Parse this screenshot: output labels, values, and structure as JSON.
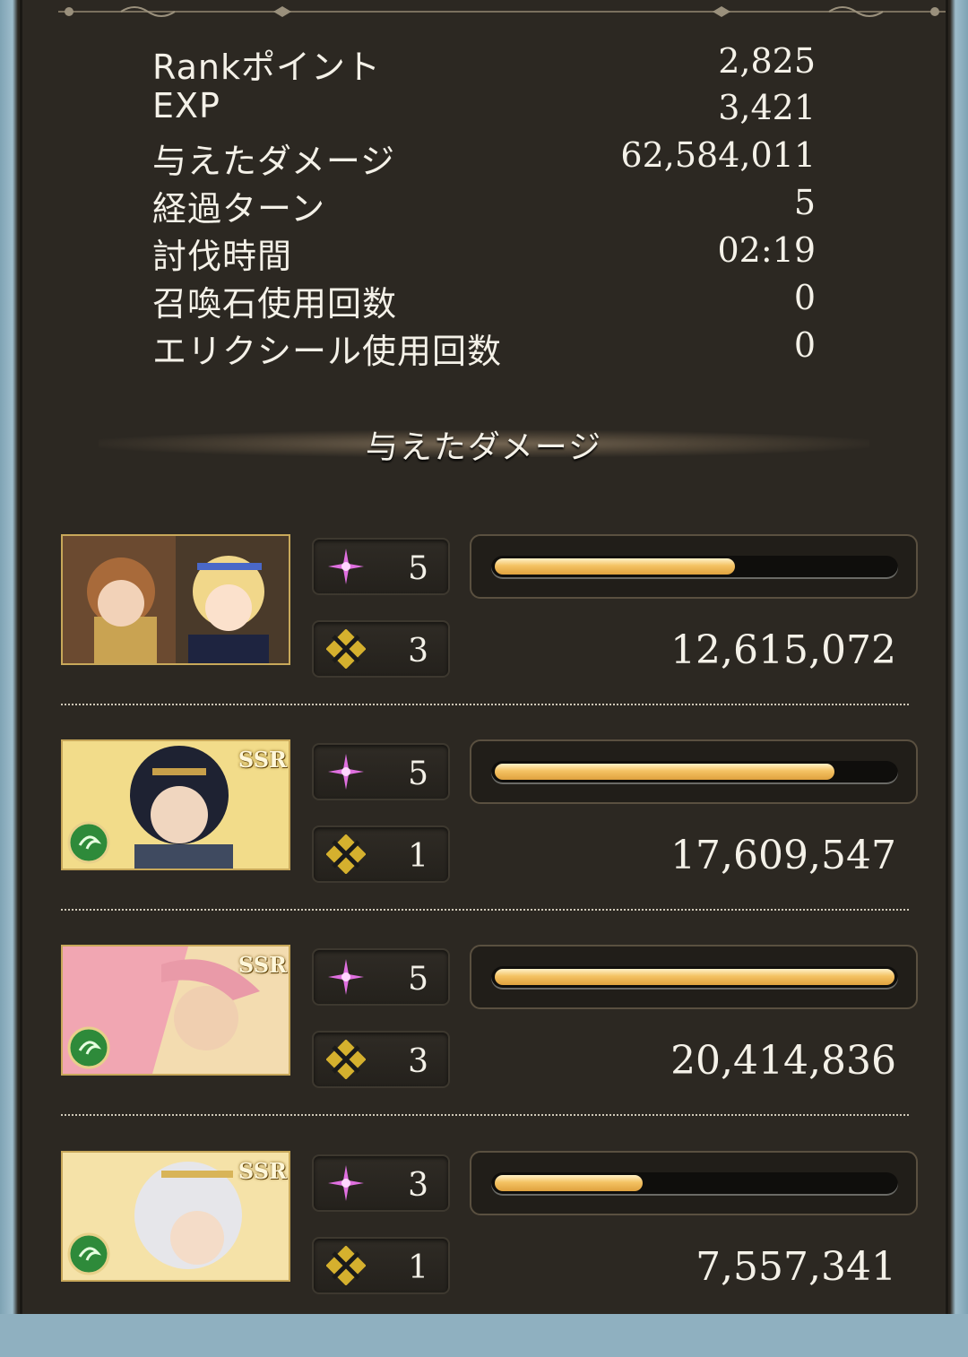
{
  "stats": [
    {
      "label": "Rankポイント",
      "value": "2,825"
    },
    {
      "label": "EXP",
      "value": "3,421"
    },
    {
      "label": "与えたダメージ",
      "value": "62,584,011"
    },
    {
      "label": "経過ターン",
      "value": "5"
    },
    {
      "label": "討伐時間",
      "value": "02:19"
    },
    {
      "label": "召喚石使用回数",
      "value": "0"
    },
    {
      "label": "エリクシール使用回数",
      "value": "0"
    }
  ],
  "damage_section": {
    "title": "与えたダメージ",
    "members": [
      {
        "skill_count": "5",
        "ability_count": "3",
        "damage": "12,615,072",
        "damage_share": 0.6,
        "ssr": "",
        "element_icon": ""
      },
      {
        "skill_count": "5",
        "ability_count": "1",
        "damage": "17,609,547",
        "damage_share": 0.85,
        "ssr": "SSR",
        "element_icon": "wind-element-icon"
      },
      {
        "skill_count": "5",
        "ability_count": "3",
        "damage": "20,414,836",
        "damage_share": 1.0,
        "ssr": "SSR",
        "element_icon": "wind-element-icon"
      },
      {
        "skill_count": "3",
        "ability_count": "1",
        "damage": "7,557,341",
        "damage_share": 0.37,
        "ssr": "SSR",
        "element_icon": "wind-element-icon"
      }
    ]
  },
  "icons": {
    "skill": "sparkle-icon",
    "ability": "crossed-swords-icon"
  },
  "colors": {
    "panel_bg": "#2c2822",
    "bar_fill": "#f4c263",
    "text": "#f4f1e8",
    "portrait_border": "#c8a85a",
    "skill_icon": "#e070e0"
  }
}
